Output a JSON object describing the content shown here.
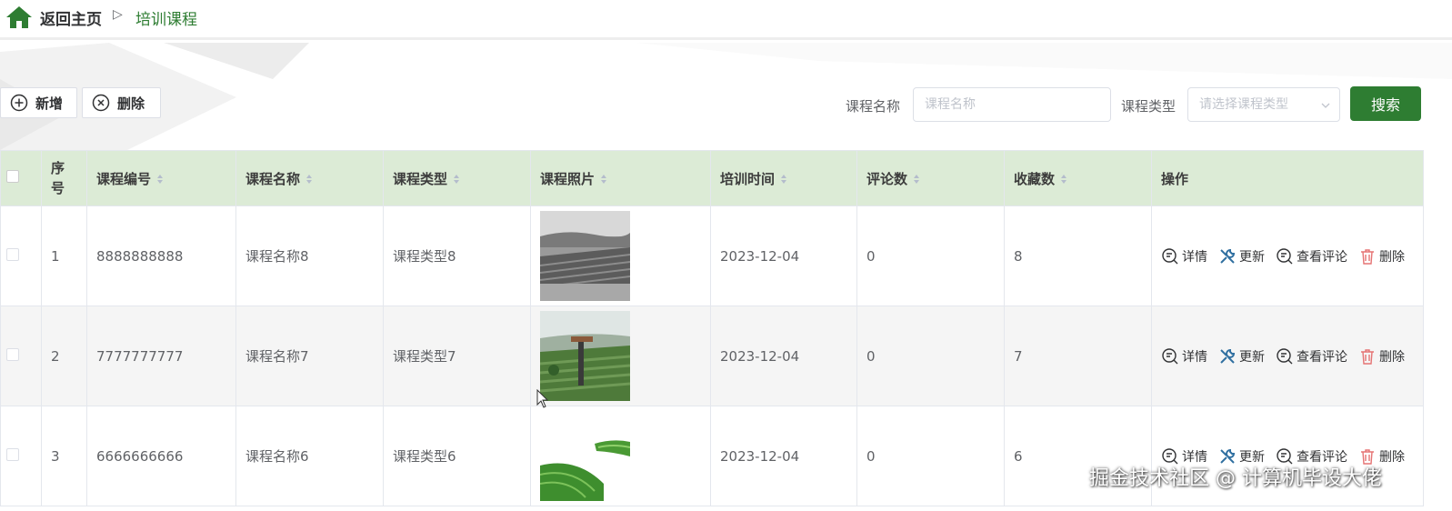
{
  "breadcrumb": {
    "home": "返回主页",
    "separator": "▷",
    "current": "培训课程"
  },
  "toolbar": {
    "add_label": "新增",
    "delete_label": "删除",
    "course_name_label": "课程名称",
    "course_name_placeholder": "课程名称",
    "course_type_label": "课程类型",
    "course_type_placeholder": "请选择课程类型",
    "search_label": "搜索"
  },
  "table": {
    "columns": [
      "序号",
      "课程编号",
      "课程名称",
      "课程类型",
      "课程照片",
      "培训时间",
      "评论数",
      "收藏数",
      "操作"
    ],
    "rows": [
      {
        "index": "1",
        "code": "8888888888",
        "name": "课程名称8",
        "type": "课程类型8",
        "photo": "grayscale-tea-field",
        "date": "2023-12-04",
        "comments": "0",
        "favorites": "8"
      },
      {
        "index": "2",
        "code": "7777777777",
        "name": "课程名称7",
        "type": "课程类型7",
        "photo": "tea-field-with-lamp",
        "date": "2023-12-04",
        "comments": "0",
        "favorites": "7"
      },
      {
        "index": "3",
        "code": "6666666666",
        "name": "课程名称6",
        "type": "课程类型6",
        "photo": "green-tea-rows",
        "date": "2023-12-04",
        "comments": "0",
        "favorites": "6"
      }
    ],
    "actions": {
      "detail": "详情",
      "update": "更新",
      "view_comments": "查看评论",
      "delete": "删除"
    }
  },
  "watermark": "掘金技术社区 @ 计算机毕设大佬",
  "colors": {
    "primary": "#2e7d32",
    "header_bg": "#dcebd6",
    "delete_icon": "#e57373"
  }
}
